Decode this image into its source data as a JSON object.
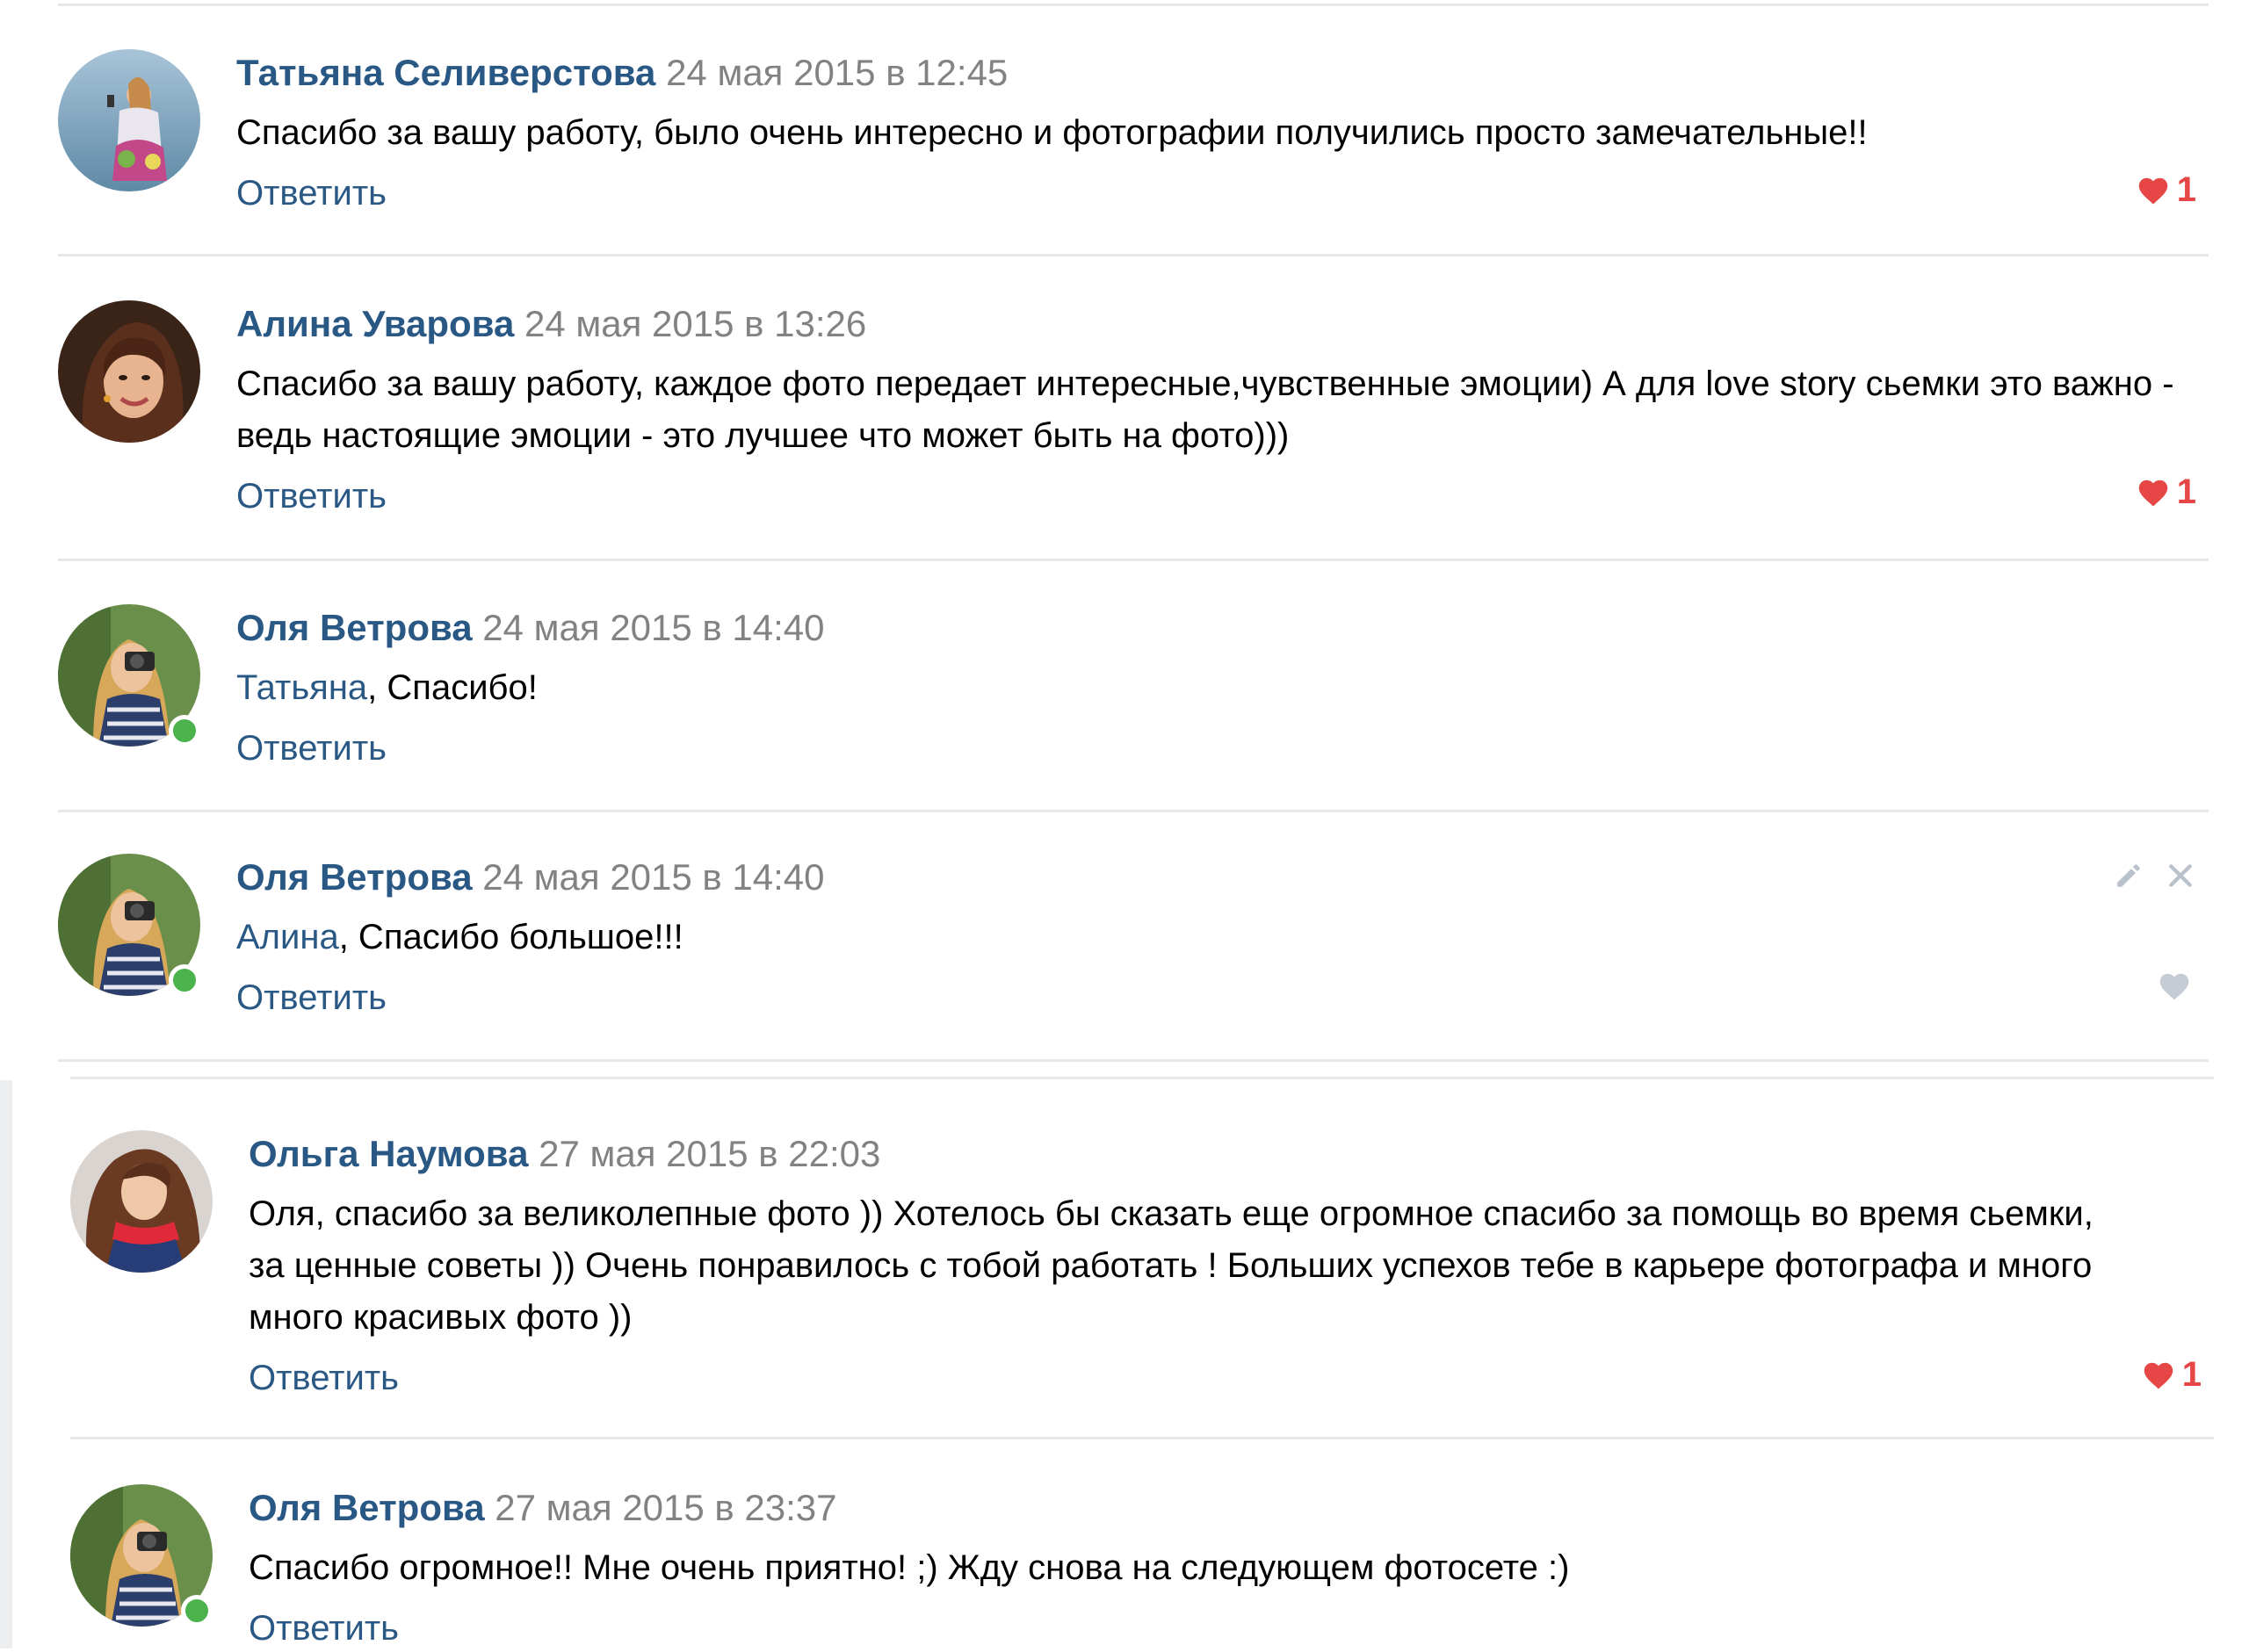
{
  "reply_label": "Ответить",
  "colors": {
    "author": "#2a5885",
    "date": "#828282",
    "like_active": "#e64646",
    "separator": "#e7e8ec",
    "online": "#4bb34b"
  },
  "comments": [
    {
      "author": "Татьяна Селиверстова",
      "date": "24 мая 2015 в 12:45",
      "text": "Спасибо за вашу работу, было очень интересно и фотографии получились просто замечательные!!",
      "likes": "1",
      "liked": true,
      "online": false
    },
    {
      "author": "Алина Уварова",
      "date": "24 мая 2015 в 13:26",
      "text": "Спасибо за вашу работу, каждое фото передает интересные,чувственные эмоции) А для love story сьемки это важно - ведь настоящие эмоции - это лучшее что может быть на фото)))",
      "likes": "1",
      "liked": true,
      "online": false
    },
    {
      "author": "Оля Ветрова",
      "date": "24 мая 2015 в 14:40",
      "mention": "Татьяна",
      "text": ", Спасибо!",
      "online": true
    },
    {
      "author": "Оля Ветрова",
      "date": "24 мая 2015 в 14:40",
      "mention": "Алина",
      "text": ", Спасибо большое!!!",
      "online": true,
      "actions": [
        "pencil-icon",
        "close-icon"
      ],
      "liked": false
    },
    {
      "author": "Ольга Наумова",
      "date": "27 мая 2015 в 22:03",
      "text": "Оля, спасибо за великолепные фото )) Хотелось бы сказать еще огромное спасибо за помощь во время сьемки, за ценные советы )) Очень понравилось с тобой работать ! Больших успехов тебе в карьере фотографа и много много красивых фото ))",
      "likes": "1",
      "liked": true,
      "online": false
    },
    {
      "author": "Оля Ветрова",
      "date": "27 мая 2015 в 23:37",
      "text": "Спасибо огромное!! Мне очень приятно! ;) Жду снова на следующем фотосете :)",
      "online": true
    }
  ]
}
